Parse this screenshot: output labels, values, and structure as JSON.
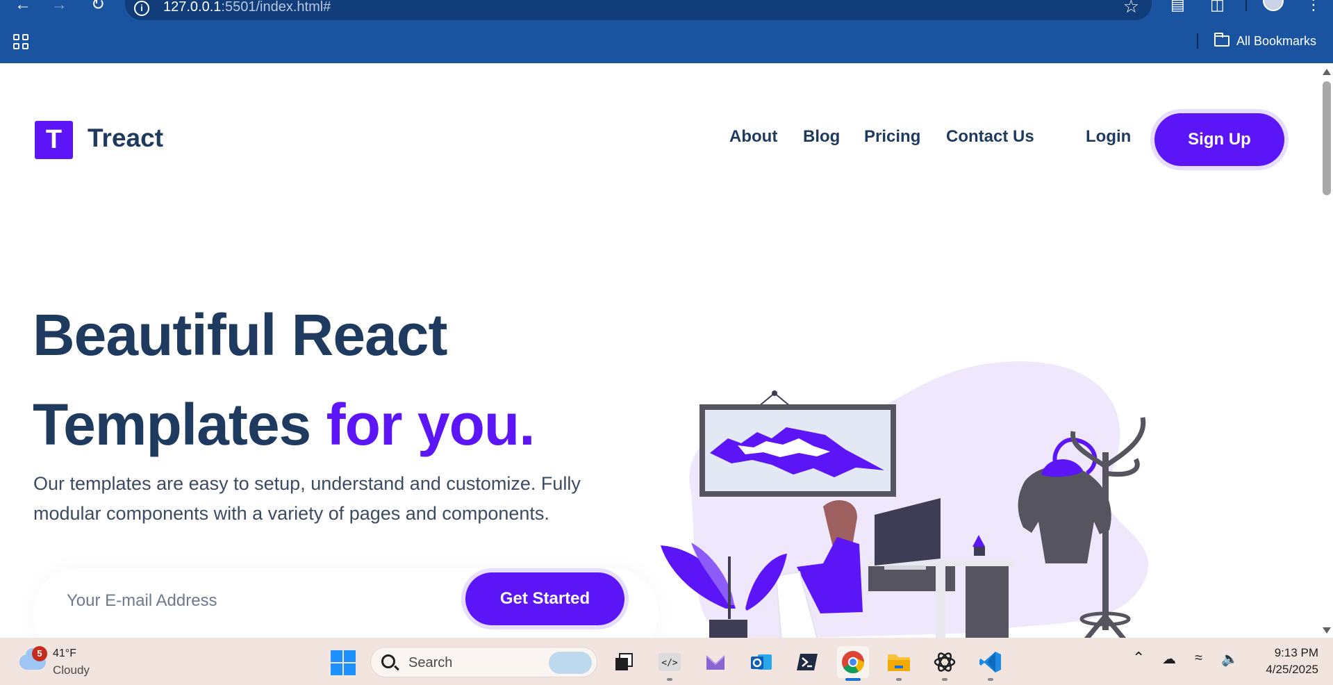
{
  "browser": {
    "url_host": "127.0.0.1",
    "url_rest": ":5501/index.html#",
    "bookmarks_label": "All Bookmarks"
  },
  "site": {
    "logo_letter": "T",
    "brand": "Treact",
    "nav": [
      "About",
      "Blog",
      "Pricing",
      "Contact Us"
    ],
    "login": "Login",
    "signup": "Sign Up",
    "accent_color": "#5b15f7",
    "heading_color": "#1e3a5f"
  },
  "hero": {
    "line1": "Beautiful React",
    "line2_plain": "Templates ",
    "line2_accent": "for you.",
    "subtitle": "Our templates are easy to setup, understand and customize. Fully modular components with a variety of pages and components.",
    "email_placeholder": "Your E-mail Address",
    "cta": "Get Started"
  },
  "taskbar": {
    "weather_badge": "5",
    "weather_temp": "41°F",
    "weather_condition": "Cloudy",
    "search_label": "Search",
    "apps": [
      "task-view",
      "code-editor",
      "mail-app",
      "outlook",
      "terminal",
      "chrome",
      "file-explorer",
      "chatgpt",
      "vscode"
    ],
    "time": "9:13 PM",
    "date": "4/25/2025"
  }
}
